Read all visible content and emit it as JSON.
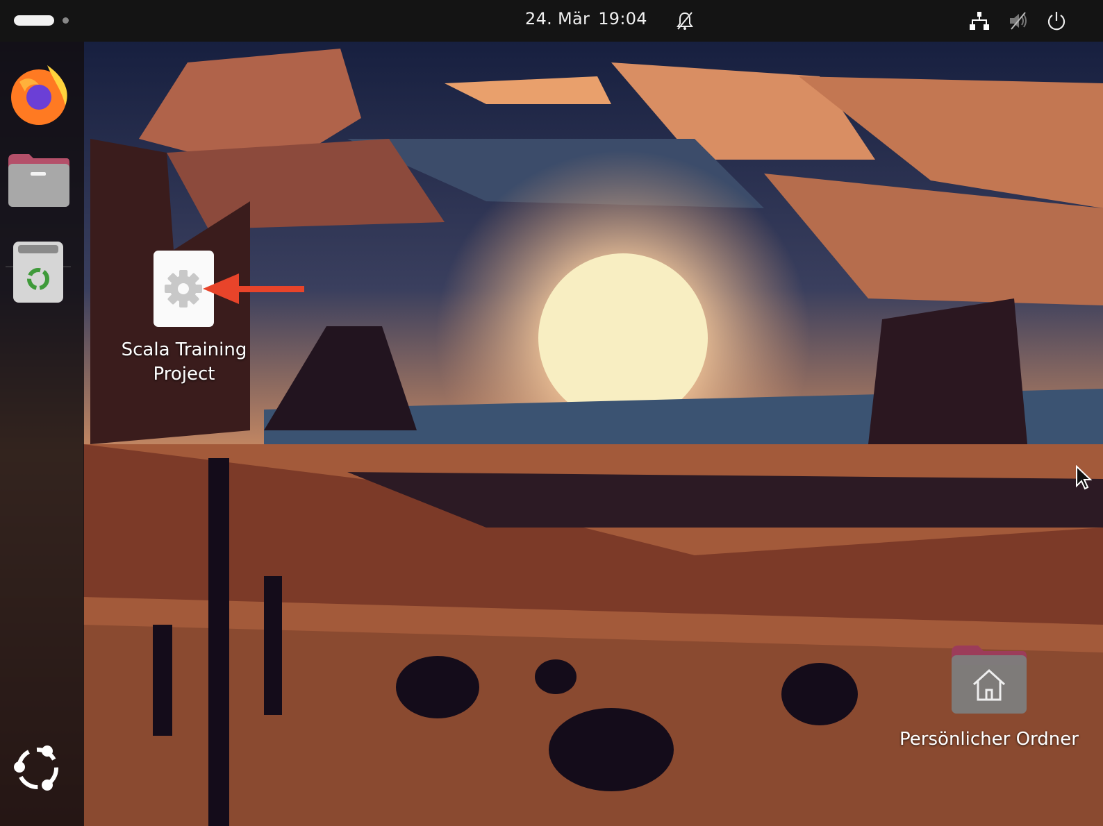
{
  "topbar": {
    "date": "24. Mär",
    "time": "19:04",
    "icons": [
      "activities-indicator",
      "notifications-muted-icon",
      "network-wired-icon",
      "volume-muted-icon",
      "power-icon"
    ]
  },
  "dock": {
    "items": [
      {
        "name": "Firefox",
        "icon": "firefox-icon"
      },
      {
        "name": "Dateien",
        "icon": "files-folder-icon"
      },
      {
        "name": "Papierkorb",
        "icon": "trash-recycle-icon"
      }
    ],
    "apps_button_icon": "ubuntu-logo-icon"
  },
  "desktop": {
    "icons": [
      {
        "label_line1": "Scala Training",
        "label_line2": "Project",
        "icon": "gear-icon"
      },
      {
        "label": "Persönlicher Ordner",
        "icon": "home-folder-icon"
      }
    ],
    "accent": "#e8442a"
  }
}
